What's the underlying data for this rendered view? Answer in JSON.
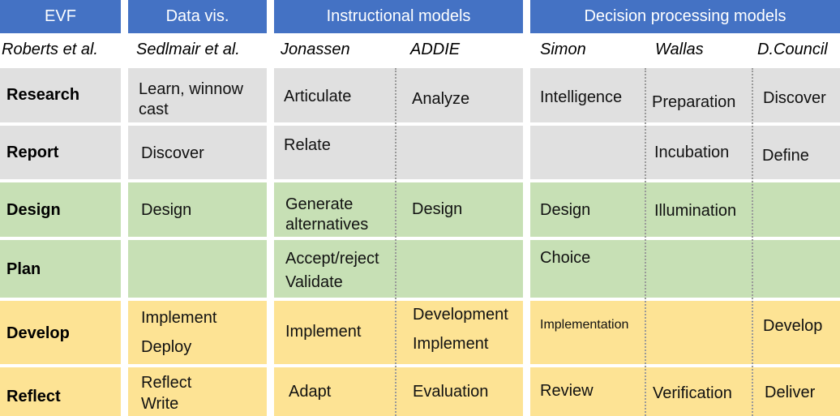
{
  "headers": {
    "evf": "EVF",
    "datavis": "Data vis.",
    "instructional": "Instructional models",
    "decision": "Decision processing models"
  },
  "sources": {
    "roberts": "Roberts et al.",
    "sedlmair": "Sedlmair et al.",
    "jonassen": "Jonassen",
    "addie": "ADDIE",
    "simon": "Simon",
    "wallas": "Wallas",
    "dcouncil": "D.Council"
  },
  "rows": {
    "research": {
      "label": "Research",
      "datavis_1": "Learn, winnow",
      "datavis_2": "cast",
      "jonassen": "Articulate",
      "addie": "Analyze",
      "simon": "Intelligence",
      "wallas": "Preparation",
      "dcouncil": "Discover"
    },
    "report": {
      "label": "Report",
      "datavis": "Discover",
      "jonassen": "Relate",
      "wallas": "Incubation",
      "dcouncil": "Define"
    },
    "design": {
      "label": "Design",
      "datavis": "Design",
      "jonassen_1": "Generate",
      "jonassen_2": "alternatives",
      "addie": "Design",
      "simon": "Design",
      "wallas": "Illumination"
    },
    "plan": {
      "label": "Plan",
      "jonassen_1": "Accept/reject",
      "jonassen_2": "Validate",
      "simon": "Choice"
    },
    "develop": {
      "label": "Develop",
      "datavis_1": "Implement",
      "datavis_2": "Deploy",
      "jonassen": "Implement",
      "addie_1": "Development",
      "addie_2": "Implement",
      "simon": "Implementation",
      "dcouncil": "Develop"
    },
    "reflect": {
      "label": "Reflect",
      "datavis_1": "Reflect",
      "datavis_2": "Write",
      "jonassen": "Adapt",
      "addie": "Evaluation",
      "simon": "Review",
      "wallas": "Verification",
      "dcouncil": "Deliver"
    }
  },
  "colors": {
    "header": "#4472c4",
    "research_report": "#e0e0e0",
    "design_plan": "#c7e0b5",
    "develop_reflect": "#fde394"
  }
}
